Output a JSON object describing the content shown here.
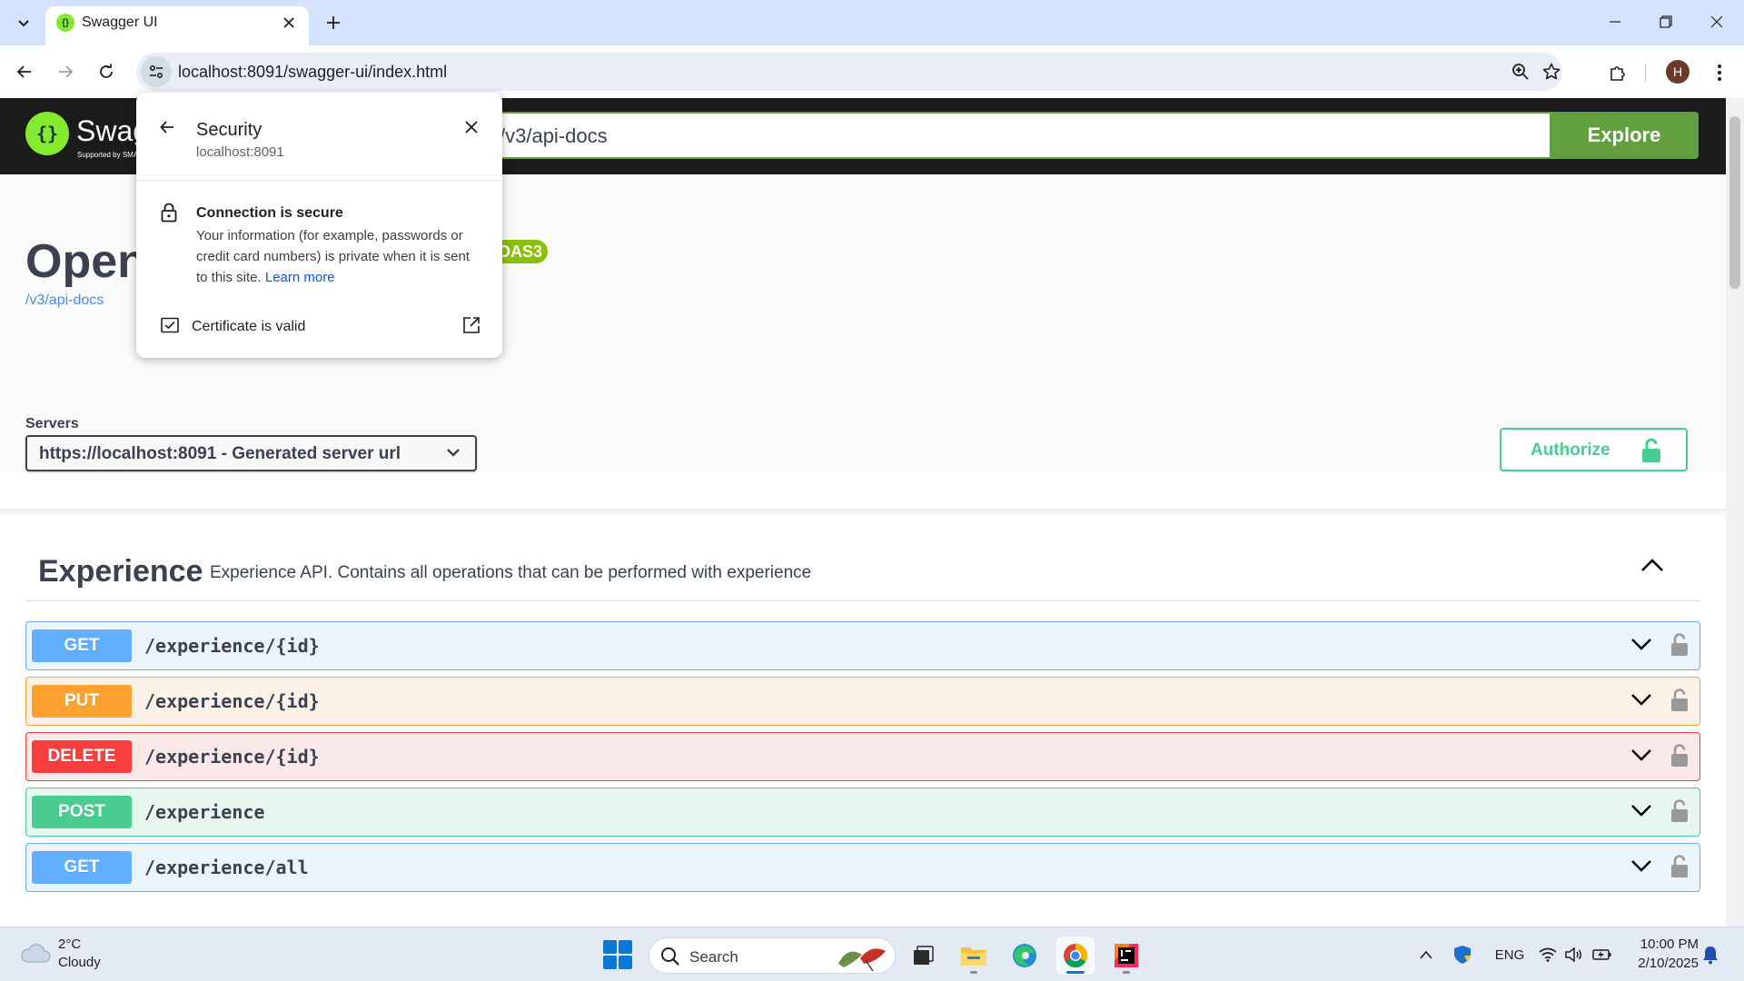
{
  "browser": {
    "tab_title": "Swagger UI",
    "url": "localhost:8091/swagger-ui/index.html",
    "profile_initial": "H"
  },
  "swagger": {
    "logo_text": "Swagger",
    "logo_sub": "Supported by SMARTBEAR",
    "explore_value": "/v3/api-docs",
    "explore_label": "Explore"
  },
  "info": {
    "title": "OpenAPI definition",
    "badge": "OAS3",
    "link": "/v3/api-docs"
  },
  "servers": {
    "label": "Servers",
    "selected": "https://localhost:8091 - Generated server url"
  },
  "authorize": {
    "label": "Authorize"
  },
  "tag": {
    "name": "Experience",
    "description": "Experience API. Contains all operations that can be performed with experience"
  },
  "operations": [
    {
      "method": "GET",
      "path": "/experience/{id}",
      "color": "#61affe",
      "bg": "#ebf3fb"
    },
    {
      "method": "PUT",
      "path": "/experience/{id}",
      "color": "#fca130",
      "bg": "#fbf1e6"
    },
    {
      "method": "DELETE",
      "path": "/experience/{id}",
      "color": "#f93e3e",
      "bg": "#fae7e7"
    },
    {
      "method": "POST",
      "path": "/experience",
      "color": "#49cc90",
      "bg": "#e8f6f0"
    },
    {
      "method": "GET",
      "path": "/experience/all",
      "color": "#61affe",
      "bg": "#ebf3fb"
    }
  ],
  "security_popup": {
    "title": "Security",
    "host": "localhost:8091",
    "connection_title": "Connection is secure",
    "connection_desc": "Your information (for example, passwords or credit card numbers) is private when it is sent to this site.",
    "learn_more": "Learn more",
    "certificate": "Certificate is valid"
  },
  "taskbar": {
    "weather_temp": "2°C",
    "weather_cond": "Cloudy",
    "search_placeholder": "Search",
    "language": "ENG",
    "time": "10:00 PM",
    "date": "2/10/2025"
  }
}
